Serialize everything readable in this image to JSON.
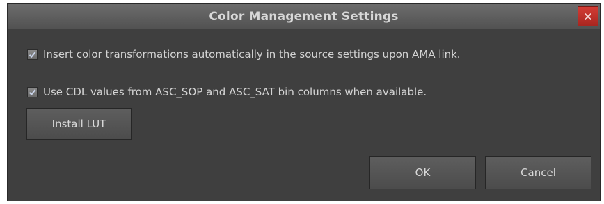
{
  "dialog": {
    "title": "Color Management Settings",
    "close_icon": "close-icon"
  },
  "options": [
    {
      "label": "Insert color transformations automatically in the source settings upon AMA link.",
      "checked": true
    },
    {
      "label": "Use CDL values from ASC_SOP and ASC_SAT bin columns when available.",
      "checked": true
    }
  ],
  "buttons": {
    "install_lut": "Install LUT",
    "ok": "OK",
    "cancel": "Cancel"
  },
  "colors": {
    "dialog_bg": "#3f3f3f",
    "title_bg": "#5c5c5c",
    "close_bg": "#c0302a",
    "text": "#d4d4d4",
    "check_mark": "#b9c6e0"
  }
}
